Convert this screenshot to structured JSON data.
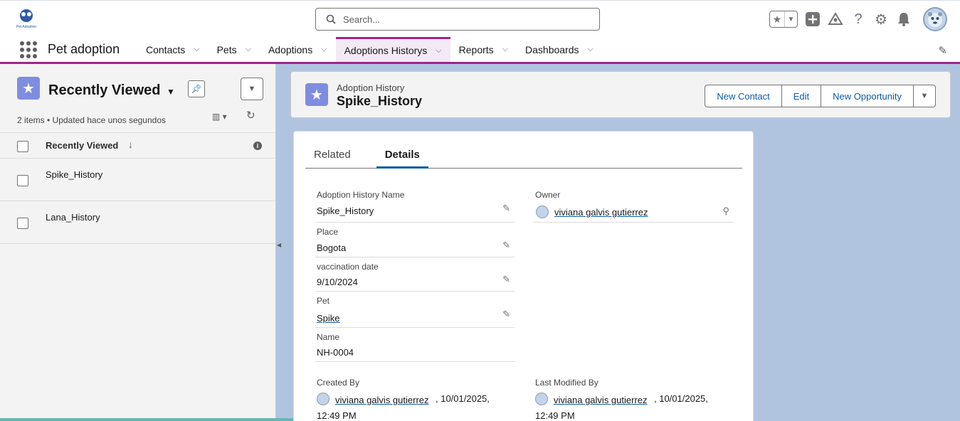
{
  "header": {
    "logo_text": "Pet Adoption",
    "search_placeholder": "Search..."
  },
  "nav": {
    "app_name": "Pet adoption",
    "items": [
      {
        "label": "Contacts"
      },
      {
        "label": "Pets"
      },
      {
        "label": "Adoptions"
      },
      {
        "label": "Adoptions Historys",
        "active": true
      },
      {
        "label": "Reports"
      },
      {
        "label": "Dashboards"
      }
    ]
  },
  "list_view": {
    "title": "Recently Viewed",
    "meta": "2 items • Updated hace unos segundos",
    "column_header": "Recently Viewed",
    "rows": [
      "Spike_History",
      "Lana_History"
    ]
  },
  "record": {
    "type": "Adoption History",
    "name": "Spike_History",
    "actions": {
      "new_contact": "New Contact",
      "edit": "Edit",
      "new_opportunity": "New Opportunity"
    },
    "tabs": {
      "related": "Related",
      "details": "Details"
    },
    "fields": {
      "name_label": "Adoption History Name",
      "name_value": "Spike_History",
      "owner_label": "Owner",
      "owner_value": "viviana galvis gutierrez",
      "place_label": "Place",
      "place_value": "Bogota",
      "vacc_label": "vaccination date",
      "vacc_value": "9/10/2024",
      "pet_label": "Pet",
      "pet_value": "Spike",
      "autoname_label": "Name",
      "autoname_value": "NH-0004",
      "created_label": "Created By",
      "created_user": "viviana galvis gutierrez",
      "created_date": ", 10/01/2025,",
      "created_time": "12:49 PM",
      "modified_label": "Last Modified By",
      "modified_user": "viviana galvis gutierrez",
      "modified_date": ", 10/01/2025,",
      "modified_time": "12:49 PM"
    }
  },
  "colors": {
    "accent": "#a0258a",
    "link": "#0b5cab",
    "object_icon": "#7f8de1"
  }
}
